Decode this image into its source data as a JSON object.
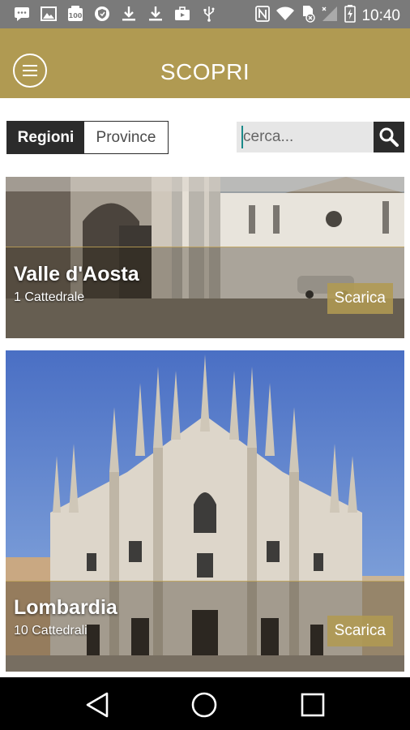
{
  "status_bar": {
    "time": "10:40",
    "left_icons": [
      "chat-bubble-icon",
      "image-icon",
      "badge-100-icon",
      "shield-icon",
      "download-icon",
      "download-icon",
      "briefcase-play-icon",
      "usb-icon"
    ],
    "right_icons": [
      "nfc-icon",
      "wifi-icon",
      "sim-off-icon",
      "signal-icon",
      "battery-charging-icon"
    ],
    "badge_text": "100"
  },
  "app_bar": {
    "title": "SCOPRI",
    "menu_icon": "menu-circle-icon",
    "color": "#b09a52"
  },
  "filters": {
    "tabs": [
      {
        "label": "Regioni",
        "selected": true
      },
      {
        "label": "Province",
        "selected": false
      }
    ]
  },
  "search": {
    "placeholder": "cerca...",
    "icon": "search-icon"
  },
  "cards": [
    {
      "name": "Valle d'Aosta",
      "count": "1 Cattedrale",
      "action": "Scarica"
    },
    {
      "name": "Lombardia",
      "count": "10 Cattedrali",
      "action": "Scarica"
    }
  ],
  "nav_bar": {
    "icons": [
      "back-triangle-icon",
      "home-circle-icon",
      "recents-square-icon"
    ]
  }
}
